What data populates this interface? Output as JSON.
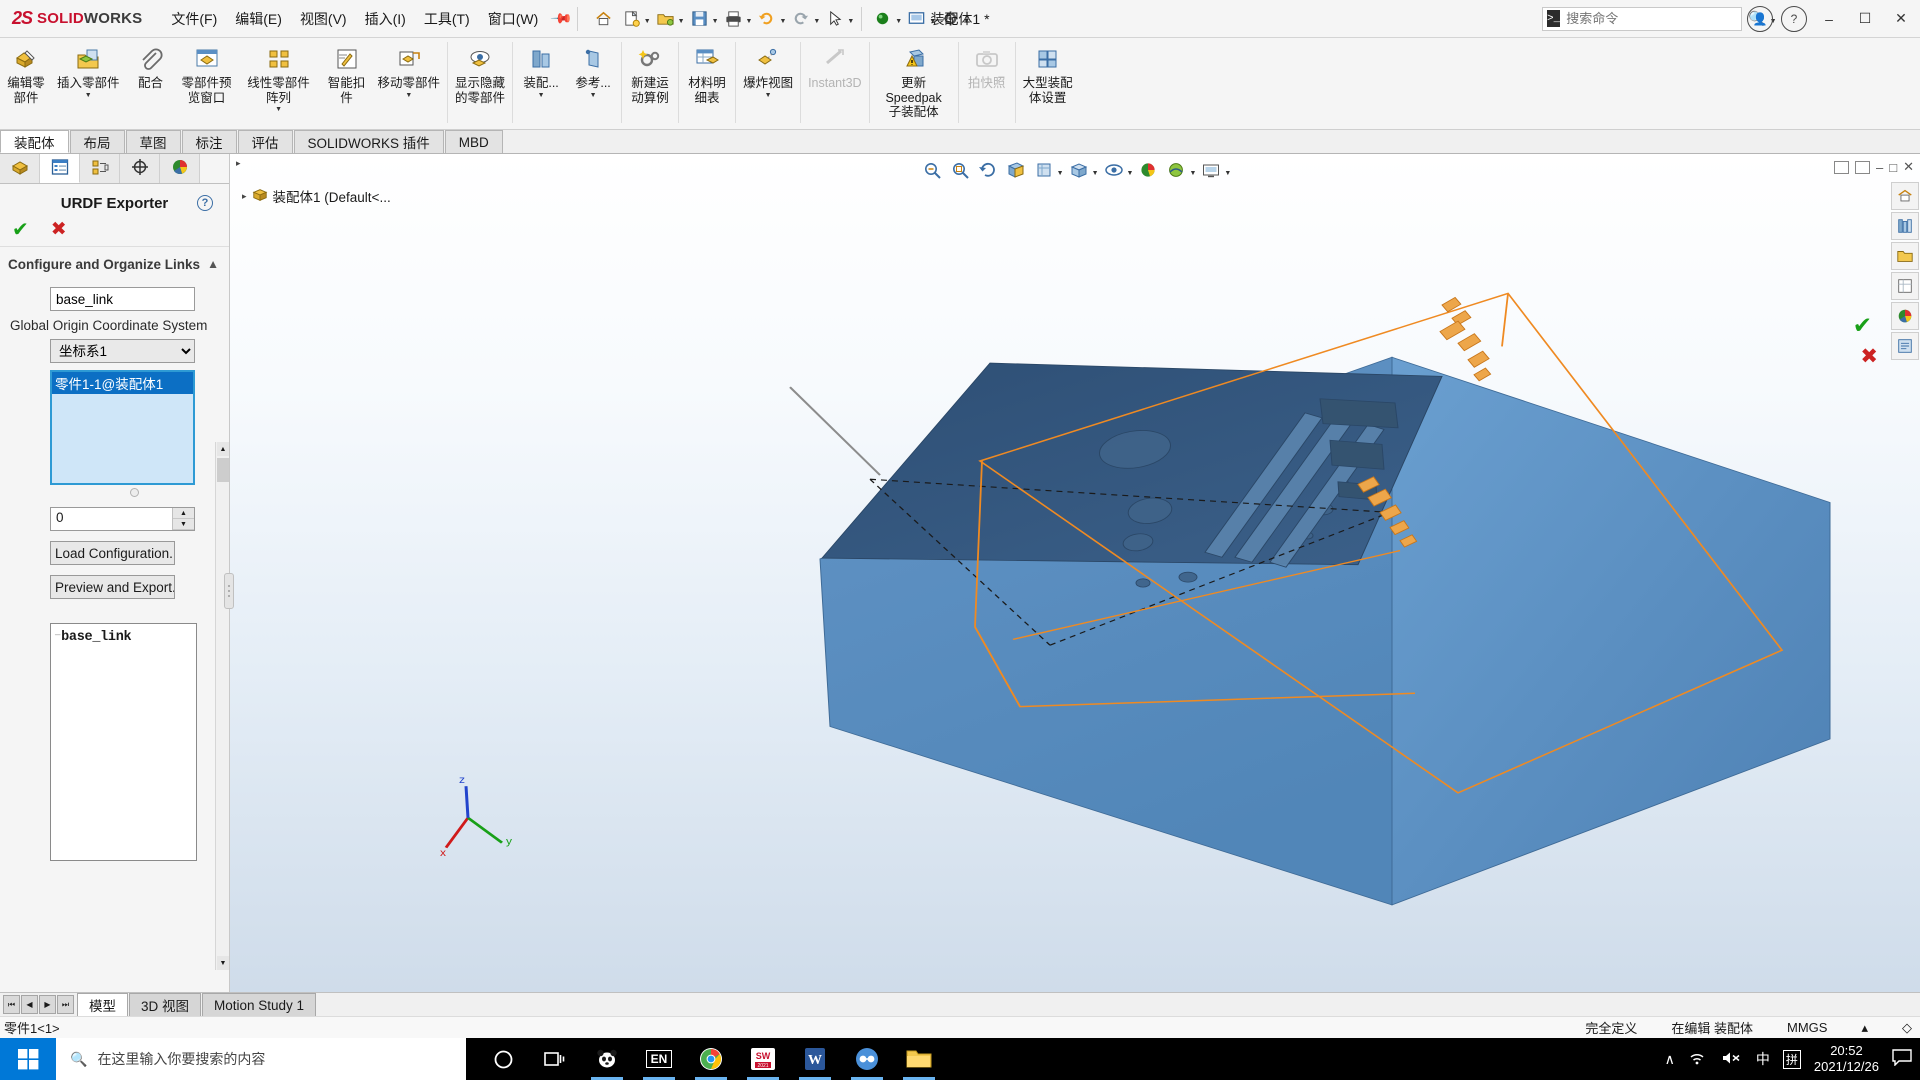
{
  "titlebar": {
    "brand_ds": "2S",
    "brand_solid": "SOLID",
    "brand_works": "WORKS",
    "menus": [
      "文件(F)",
      "编辑(E)",
      "视图(V)",
      "插入(I)",
      "工具(T)",
      "窗口(W)"
    ],
    "doc_title": "装配体1 *",
    "search_placeholder": "搜索命令",
    "search_value": "",
    "minimize": "–",
    "maximize": "☐",
    "close": "✕"
  },
  "ribbon": {
    "buttons": [
      {
        "label": "编辑零\n部件",
        "dd": false,
        "disabled": false
      },
      {
        "label": "插入零部件",
        "dd": true,
        "disabled": false
      },
      {
        "label": "配合",
        "dd": false,
        "disabled": false
      },
      {
        "label": "零部件预\n览窗口",
        "dd": false,
        "disabled": false
      },
      {
        "label": "线性零部件阵列",
        "dd": true,
        "disabled": false
      },
      {
        "label": "智能扣\n件",
        "dd": false,
        "disabled": false
      },
      {
        "label": "移动零部件",
        "dd": true,
        "disabled": false
      },
      {
        "label": "显示隐藏\n的零部件",
        "dd": false,
        "disabled": false
      },
      {
        "label": "装配...",
        "dd": true,
        "disabled": false
      },
      {
        "label": "参考...",
        "dd": true,
        "disabled": false
      },
      {
        "label": "新建运\n动算例",
        "dd": false,
        "disabled": false
      },
      {
        "label": "材料明\n细表",
        "dd": false,
        "disabled": false
      },
      {
        "label": "爆炸视图",
        "dd": true,
        "disabled": false
      },
      {
        "label": "Instant3D",
        "dd": false,
        "disabled": true
      },
      {
        "label": "更新 Speedpak\n子装配体",
        "dd": false,
        "disabled": false
      },
      {
        "label": "拍快照",
        "dd": false,
        "disabled": true
      },
      {
        "label": "大型装配\n体设置",
        "dd": false,
        "disabled": false
      }
    ]
  },
  "doctabs": {
    "tabs": [
      {
        "label": "装配体",
        "active": true
      },
      {
        "label": "布局",
        "active": false
      },
      {
        "label": "草图",
        "active": false
      },
      {
        "label": "标注",
        "active": false
      },
      {
        "label": "评估",
        "active": false
      },
      {
        "label": "SOLIDWORKS 插件",
        "active": false
      },
      {
        "label": "MBD",
        "active": false
      }
    ]
  },
  "propertymanager": {
    "tabs": [
      "feature-tree-icon",
      "property-manager-icon",
      "configuration-manager-icon",
      "dimxpert-icon",
      "appearances-icon"
    ],
    "title": "URDF Exporter",
    "help": "?",
    "ok": "✔",
    "cancel": "✖",
    "section_title": "Configure and Organize Links",
    "link_name_value": "base_link",
    "link_name_placeholder": "",
    "origin_caption": "Global Origin Coordinate System",
    "coord_selected": "坐标系1",
    "coord_options": [
      "坐标系1"
    ],
    "component_selected": "零件1-1@装配体1",
    "numeric_value": "0",
    "load_config_label": "Load Configuration..",
    "preview_export_label": "Preview and Export..",
    "tree_root": "base_link"
  },
  "featuretree": {
    "root_label": "装配体1  (Default<...",
    "expand_arrow": "▸"
  },
  "graphics": {
    "triad_x": "x",
    "triad_y": "y",
    "triad_z": "z"
  },
  "bottomtabs": {
    "tabs": [
      {
        "label": "模型",
        "active": true
      },
      {
        "label": "3D 视图",
        "active": false
      },
      {
        "label": "Motion Study 1",
        "active": false
      }
    ]
  },
  "statusbar": {
    "left": "零件1<1>",
    "state": "完全定义",
    "editing": "在编辑 装配体",
    "units": "MMGS",
    "units_caret": "▴"
  },
  "taskbar": {
    "search_placeholder": "在这里输入你要搜索的内容",
    "apps": [
      "cortana-icon",
      "task-view-icon",
      "panda-antivirus-icon",
      "ime-en-icon",
      "chrome-icon",
      "solidworks-icon",
      "word-icon",
      "collab-icon",
      "file-explorer-icon"
    ],
    "ime_lang": "中",
    "ime_pinyin": "拼",
    "time": "20:52",
    "date": "2021/12/26",
    "chevron": "∧"
  }
}
